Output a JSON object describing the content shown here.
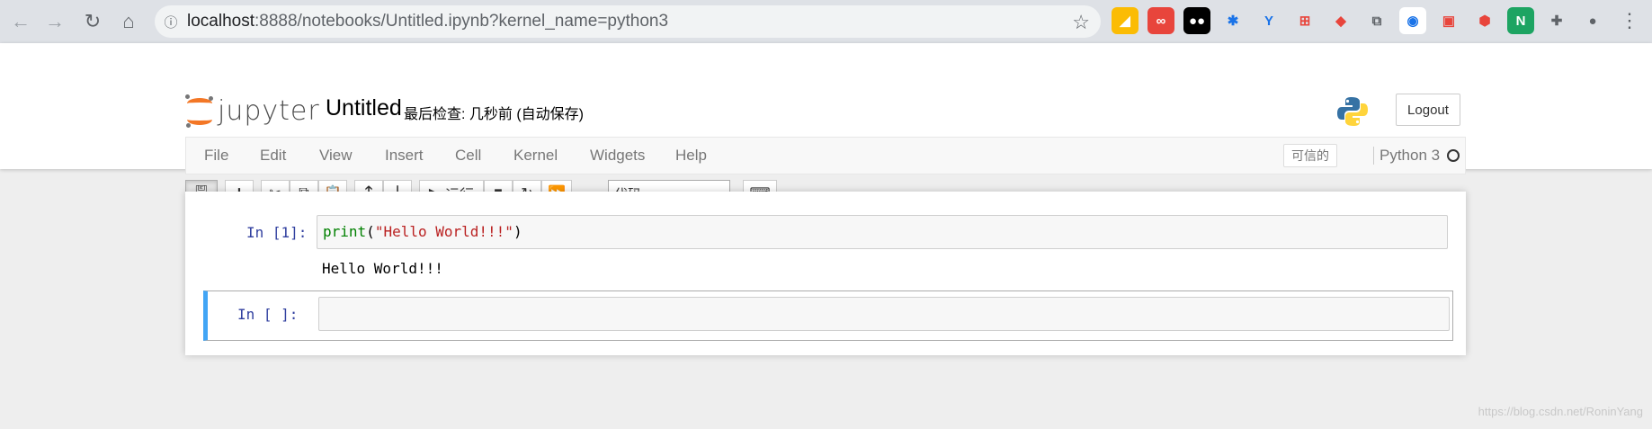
{
  "browser": {
    "url_host": "localhost",
    "url_path": ":8888/notebooks/Untitled.ipynb?kernel_name=python3",
    "extensions": [
      {
        "name": "drive-ext",
        "bg": "#fbbc04",
        "glyph": "◢"
      },
      {
        "name": "infinity-ext",
        "bg": "#e8453c",
        "glyph": "∞"
      },
      {
        "name": "tampermonkey-ext",
        "bg": "#000000",
        "glyph": "●●"
      },
      {
        "name": "asterisk-ext",
        "bg": "#dee1e6",
        "glyph": "✱"
      },
      {
        "name": "y-ext",
        "bg": "#dee1e6",
        "glyph": "Y"
      },
      {
        "name": "sitemap-ext",
        "bg": "#dee1e6",
        "glyph": "⊞"
      },
      {
        "name": "gitlab-ext",
        "bg": "#dee1e6",
        "glyph": "◆"
      },
      {
        "name": "copy-ext",
        "bg": "#dee1e6",
        "glyph": "⧉"
      },
      {
        "name": "chrome-ext",
        "bg": "#ffffff",
        "glyph": "◉"
      },
      {
        "name": "bilibili-ext",
        "bg": "#dee1e6",
        "glyph": "▣"
      },
      {
        "name": "shield-ext",
        "bg": "#dee1e6",
        "glyph": "⬢"
      },
      {
        "name": "n-ext",
        "bg": "#1da462",
        "glyph": "N"
      },
      {
        "name": "puzzle-ext",
        "bg": "#dee1e6",
        "glyph": "✚"
      },
      {
        "name": "profile-ext",
        "bg": "#dee1e6",
        "glyph": "●"
      }
    ]
  },
  "jupyter": {
    "logo_text": "jupyter",
    "notebook_title": "Untitled",
    "checkpoint": "最后检查: 几秒前  (自动保存)",
    "logout_label": "Logout",
    "menu": [
      "File",
      "Edit",
      "View",
      "Insert",
      "Cell",
      "Kernel",
      "Widgets",
      "Help"
    ],
    "trusted_label": "可信的",
    "kernel_name": "Python 3",
    "run_label": "运行",
    "cell_type": "代码"
  },
  "cells": [
    {
      "prompt": "In  [1]:",
      "code_fn": "print",
      "code_open": "(",
      "code_str": "\"Hello World!!!\"",
      "code_close": ")",
      "output": "Hello World!!!"
    },
    {
      "prompt": "In  [ ]:"
    }
  ],
  "watermark": "https://blog.csdn.net/RoninYang",
  "colors": {
    "accent": "#42a5f5",
    "logo_orange": "#f37726",
    "prompt_blue": "#303f9f"
  }
}
